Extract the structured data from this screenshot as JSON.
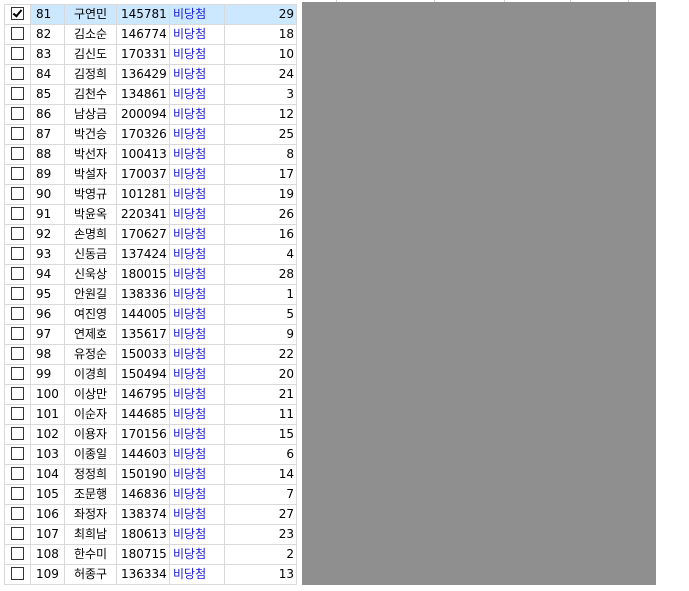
{
  "rows": [
    {
      "checked": true,
      "no": "81",
      "name": "구연민",
      "id": "145781",
      "status": "비당첨",
      "value": "29"
    },
    {
      "checked": false,
      "no": "82",
      "name": "김소순",
      "id": "146774",
      "status": "비당첨",
      "value": "18"
    },
    {
      "checked": false,
      "no": "83",
      "name": "김신도",
      "id": "170331",
      "status": "비당첨",
      "value": "10"
    },
    {
      "checked": false,
      "no": "84",
      "name": "김정희",
      "id": "136429",
      "status": "비당첨",
      "value": "24"
    },
    {
      "checked": false,
      "no": "85",
      "name": "김천수",
      "id": "134861",
      "status": "비당첨",
      "value": "3"
    },
    {
      "checked": false,
      "no": "86",
      "name": "남상금",
      "id": "200094",
      "status": "비당첨",
      "value": "12"
    },
    {
      "checked": false,
      "no": "87",
      "name": "박건승",
      "id": "170326",
      "status": "비당첨",
      "value": "25"
    },
    {
      "checked": false,
      "no": "88",
      "name": "박선자",
      "id": "100413",
      "status": "비당첨",
      "value": "8"
    },
    {
      "checked": false,
      "no": "89",
      "name": "박설자",
      "id": "170037",
      "status": "비당첨",
      "value": "17"
    },
    {
      "checked": false,
      "no": "90",
      "name": "박영규",
      "id": "101281",
      "status": "비당첨",
      "value": "19"
    },
    {
      "checked": false,
      "no": "91",
      "name": "박윤옥",
      "id": "220341",
      "status": "비당첨",
      "value": "26"
    },
    {
      "checked": false,
      "no": "92",
      "name": "손명희",
      "id": "170627",
      "status": "비당첨",
      "value": "16"
    },
    {
      "checked": false,
      "no": "93",
      "name": "신동금",
      "id": "137424",
      "status": "비당첨",
      "value": "4"
    },
    {
      "checked": false,
      "no": "94",
      "name": "신욱상",
      "id": "180015",
      "status": "비당첨",
      "value": "28"
    },
    {
      "checked": false,
      "no": "95",
      "name": "안원길",
      "id": "138336",
      "status": "비당첨",
      "value": "1"
    },
    {
      "checked": false,
      "no": "96",
      "name": "여진영",
      "id": "144005",
      "status": "비당첨",
      "value": "5"
    },
    {
      "checked": false,
      "no": "97",
      "name": "연제호",
      "id": "135617",
      "status": "비당첨",
      "value": "9"
    },
    {
      "checked": false,
      "no": "98",
      "name": "유정순",
      "id": "150033",
      "status": "비당첨",
      "value": "22"
    },
    {
      "checked": false,
      "no": "99",
      "name": "이경희",
      "id": "150494",
      "status": "비당첨",
      "value": "20"
    },
    {
      "checked": false,
      "no": "100",
      "name": "이상만",
      "id": "146795",
      "status": "비당첨",
      "value": "21"
    },
    {
      "checked": false,
      "no": "101",
      "name": "이순자",
      "id": "144685",
      "status": "비당첨",
      "value": "11"
    },
    {
      "checked": false,
      "no": "102",
      "name": "이용자",
      "id": "170156",
      "status": "비당첨",
      "value": "15"
    },
    {
      "checked": false,
      "no": "103",
      "name": "이종일",
      "id": "144603",
      "status": "비당첨",
      "value": "6"
    },
    {
      "checked": false,
      "no": "104",
      "name": "정정희",
      "id": "150190",
      "status": "비당첨",
      "value": "14"
    },
    {
      "checked": false,
      "no": "105",
      "name": "조문행",
      "id": "146836",
      "status": "비당첨",
      "value": "7"
    },
    {
      "checked": false,
      "no": "106",
      "name": "좌정자",
      "id": "138374",
      "status": "비당첨",
      "value": "27"
    },
    {
      "checked": false,
      "no": "107",
      "name": "최희남",
      "id": "180613",
      "status": "비당첨",
      "value": "23"
    },
    {
      "checked": false,
      "no": "108",
      "name": "한수미",
      "id": "180715",
      "status": "비당첨",
      "value": "2"
    },
    {
      "checked": false,
      "no": "109",
      "name": "허종구",
      "id": "136334",
      "status": "비당첨",
      "value": "13"
    }
  ],
  "colors": {
    "selected_row": "#cce8ff",
    "status_text": "#1a1adb",
    "gray_panel": "#8f8f8f",
    "grid_line": "#d9d9d9"
  },
  "icons": {
    "checkbox_checked": "checkmark-box-icon",
    "checkbox_unchecked": "empty-box-icon"
  }
}
